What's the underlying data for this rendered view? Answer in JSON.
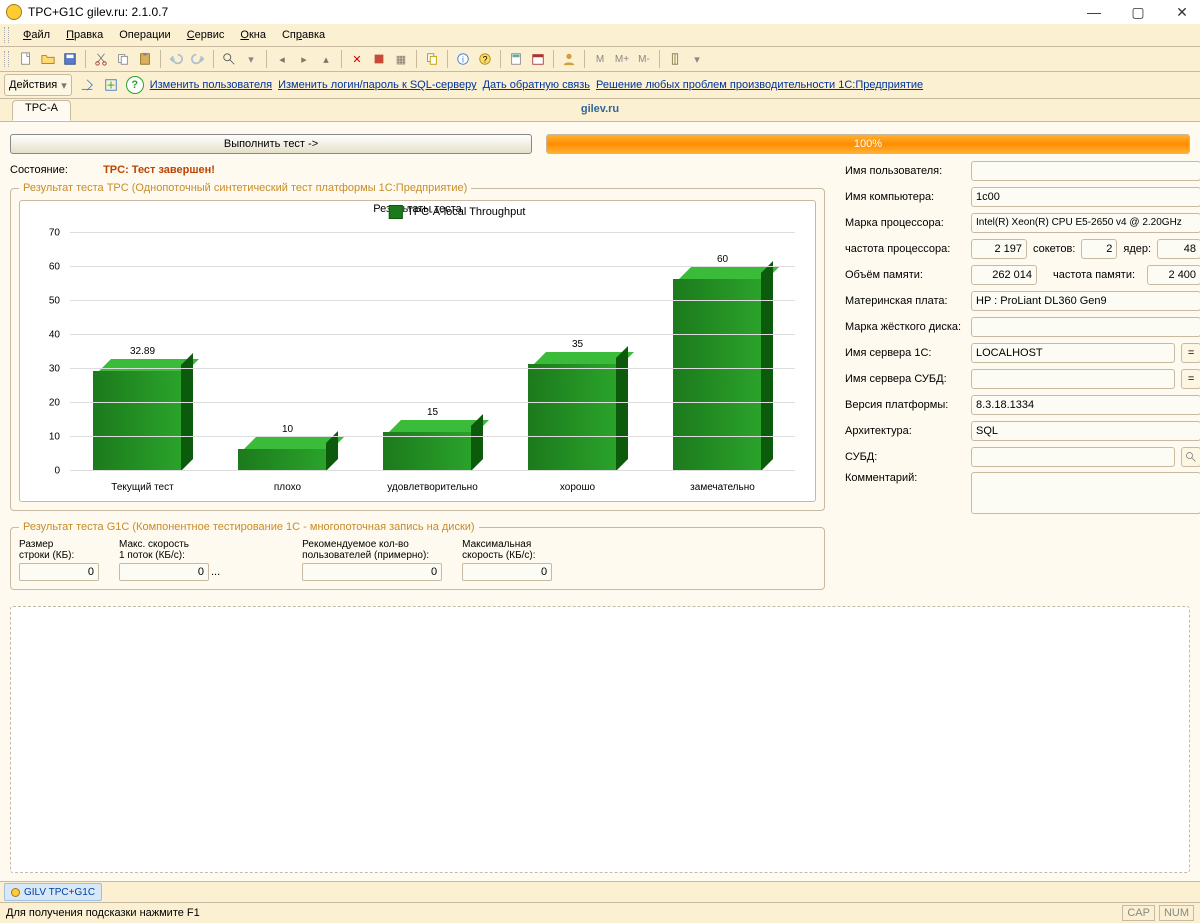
{
  "window": {
    "title": "TPC+G1C gilev.ru: 2.1.0.7"
  },
  "menu": {
    "items": [
      "<u>Ф</u>айл",
      "<u>П</u>равка",
      "Операции",
      "<u>С</u>ервис",
      "<u>О</u>кна",
      "Сп<u>р</u>авка"
    ]
  },
  "actions": {
    "dropdown": "Действия",
    "links": [
      "Изменить пользователя",
      "Изменить логин/пароль к SQL-серверу",
      "Дать обратную связь",
      "Решение любых проблем производительности 1С:Предприятие"
    ]
  },
  "tab": "TPC-A",
  "centerlink": "gilev.ru",
  "run_button": "Выполнить тест ->",
  "progress": "100%",
  "status": {
    "label": "Состояние:",
    "value": "TPC: Тест завершен!"
  },
  "tpc_fieldset": "Результат теста TPC (Однопоточный синтетический тест платформы 1С:Предприятие)",
  "g1c_fieldset": "Результат теста G1C (Компонентное тестирование 1С - многопоточная запись на диски)",
  "g1c": {
    "labels": [
      "Размер\nстроки (КБ):",
      "Макс. скорость\n1 поток (КБ/с):",
      "Рекомендуемое кол-во\nпользователей (примерно):",
      "Максимальная\nскорость (КБ/с):"
    ],
    "values": [
      "0",
      "0",
      "0",
      "0"
    ]
  },
  "fields": {
    "username_l": "Имя пользователя:",
    "username": "",
    "computer_l": "Имя компьютера:",
    "computer": "1c00",
    "cpu_l": "Марка процессора:",
    "cpu": "Intel(R) Xeon(R) CPU E5-2650 v4 @ 2.20GHz",
    "cpufreq_l": "частота процессора:",
    "cpufreq": "2 197",
    "sockets_l": "сокетов:",
    "sockets": "2",
    "cores_l": "ядер:",
    "cores": "48",
    "ram_l": "Объём памяти:",
    "ram": "262 014",
    "ramfreq_l": "частота памяти:",
    "ramfreq": "2 400",
    "mb_l": "Материнская плата:",
    "mb": "HP : ProLiant DL360 Gen9",
    "hdd_l": "Марка жёсткого диска:",
    "hdd": "",
    "srv1c_l": "Имя сервера 1С:",
    "srv1c": "LOCALHOST",
    "srvdb_l": "Имя сервера СУБД:",
    "srvdb": "",
    "platver_l": "Версия платформы:",
    "platver": "8.3.18.1334",
    "arch_l": "Архитектура:",
    "arch": "SQL",
    "subd_l": "СУБД:",
    "subd": "",
    "comment_l": "Комментарий:"
  },
  "taskbar": "GILV TPC+G1C",
  "statusbar": {
    "hint": "Для получения подсказки нажмите F1",
    "cap": "CAP",
    "num": "NUM"
  },
  "chart_data": {
    "type": "bar",
    "title": "Результаты теста",
    "legend": "TPC-A-local Throughput",
    "ylim": [
      0,
      70
    ],
    "yticks": [
      0,
      10,
      20,
      30,
      40,
      50,
      60,
      70
    ],
    "categories": [
      "Текущий тест",
      "плохо",
      "удовлетворительно",
      "хорошо",
      "замечательно"
    ],
    "values": [
      32.89,
      10,
      15,
      35,
      60
    ],
    "labels": [
      "32.89",
      "10",
      "15",
      "35",
      "60"
    ]
  }
}
